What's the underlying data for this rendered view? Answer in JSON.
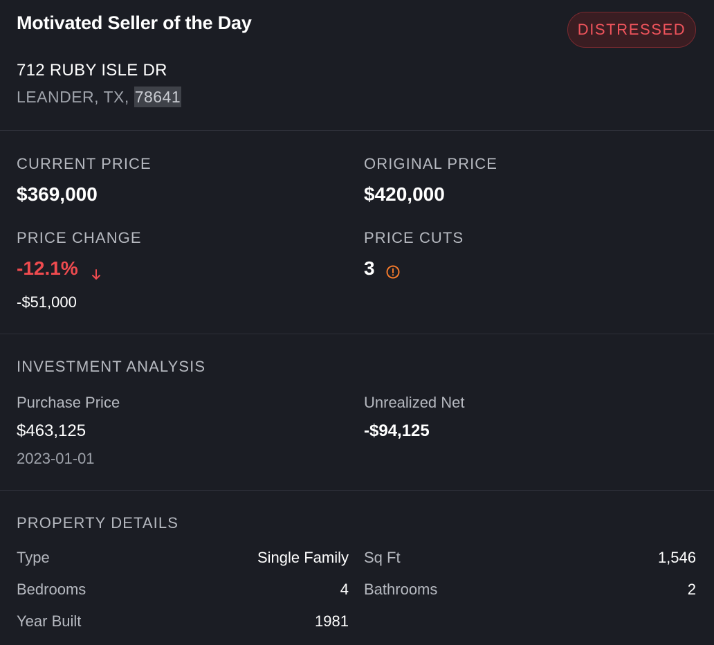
{
  "header": {
    "title": "Motivated Seller of the Day",
    "badge": "DISTRESSED",
    "address_line1": "712 RUBY ISLE DR",
    "address_city_state": "LEANDER, TX, ",
    "address_zip": "78641"
  },
  "pricing": {
    "current_price_label": "CURRENT PRICE",
    "current_price": "$369,000",
    "original_price_label": "ORIGINAL PRICE",
    "original_price": "$420,000",
    "price_change_label": "PRICE CHANGE",
    "price_change_pct": "-12.1%",
    "price_change_amount": "-$51,000",
    "price_cuts_label": "PRICE CUTS",
    "price_cuts": "3"
  },
  "investment": {
    "heading": "INVESTMENT ANALYSIS",
    "purchase_price_label": "Purchase Price",
    "purchase_price": "$463,125",
    "purchase_date": "2023-01-01",
    "unrealized_net_label": "Unrealized Net",
    "unrealized_net": "-$94,125"
  },
  "details": {
    "heading": "PROPERTY DETAILS",
    "type_label": "Type",
    "type_value": "Single Family",
    "sqft_label": "Sq Ft",
    "sqft_value": "1,546",
    "bedrooms_label": "Bedrooms",
    "bedrooms_value": "4",
    "bathrooms_label": "Bathrooms",
    "bathrooms_value": "2",
    "year_built_label": "Year Built",
    "year_built_value": "1981"
  },
  "icons": {
    "price_change_direction": "arrow-down-icon",
    "price_cuts_indicator": "alert-circle-icon"
  },
  "colors": {
    "background": "#1b1d24",
    "negative": "#ef4b4f",
    "warning": "#f2792b",
    "badge_text": "#f0545c"
  }
}
